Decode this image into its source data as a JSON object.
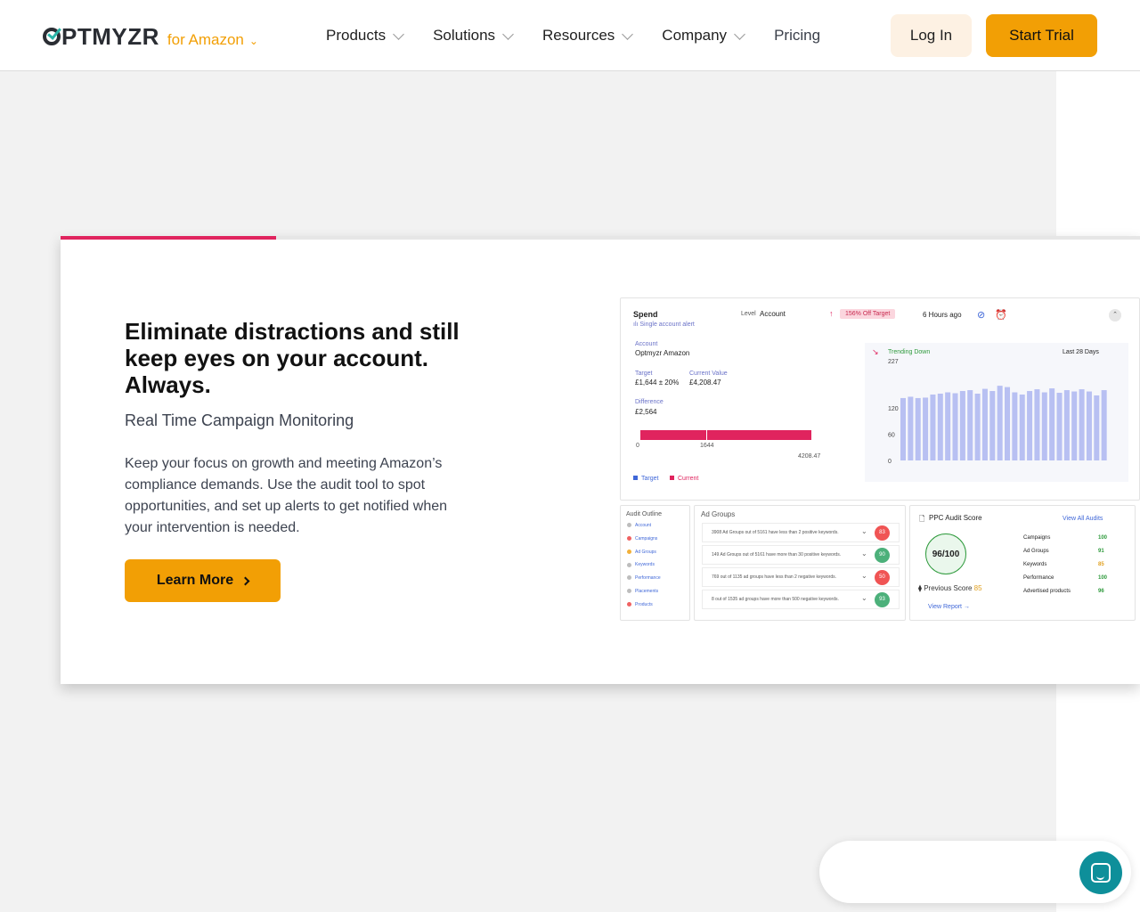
{
  "header": {
    "logo_text": "PTMYZR",
    "logo_suffix": "for Amazon",
    "nav": [
      {
        "label": "Products"
      },
      {
        "label": "Solutions"
      },
      {
        "label": "Resources"
      },
      {
        "label": "Company"
      }
    ],
    "pricing_label": "Pricing",
    "login_label": "Log In",
    "trial_label": "Start Trial"
  },
  "feature": {
    "progress_fraction": 0.2,
    "headline": "Eliminate distractions and still keep eyes on your account. Always.",
    "subheadline": "Real Time Campaign Monitoring",
    "body": "Keep your focus on growth and meeting Amazon’s compliance demands. Use the audit tool to spot opportunities, and set up alerts to get notified when your intervention is needed.",
    "cta_label": "Learn More"
  },
  "dashboard": {
    "spend": {
      "title": "Spend",
      "subtitle": "Single account alert",
      "level_label": "Level",
      "level_value": "Account",
      "badge": "156% Off Target",
      "time": "6 Hours ago",
      "account_label": "Account",
      "account_value": "Optmyzr Amazon",
      "target_label": "Target",
      "target_value": "£1,644 ± 20%",
      "current_label": "Current Value",
      "current_value": "£4,208.47",
      "difference_label": "Difference",
      "difference_value": "£2,564",
      "bar_axis": [
        "0",
        "1644",
        "4208.47"
      ],
      "legend_target": "Target",
      "legend_current": "Current"
    },
    "trend": {
      "label": "Trending Down",
      "range": "Last 28 Days",
      "y_ticks": [
        "227",
        "120",
        "60",
        "0"
      ]
    },
    "audit_outline": {
      "title": "Audit Outline",
      "items": [
        {
          "label": "Account",
          "color": "#bdbdbd"
        },
        {
          "label": "Campaigns",
          "color": "#f06262"
        },
        {
          "label": "Ad Groups",
          "color": "#f2b03a"
        },
        {
          "label": "Keywords",
          "color": "#bdbdbd"
        },
        {
          "label": "Performance",
          "color": "#bdbdbd"
        },
        {
          "label": "Placements",
          "color": "#bdbdbd"
        },
        {
          "label": "Products",
          "color": "#f06262"
        }
      ]
    },
    "ad_groups": {
      "title": "Ad Groups",
      "rows": [
        {
          "text": "3908 Ad Groups out of 5161 have less than 2 positive keywords.",
          "score": "83",
          "color": "#f05454"
        },
        {
          "text": "149 Ad Groups out of 5161 have more than 30 positive keywords.",
          "score": "90",
          "color": "#4cb07a"
        },
        {
          "text": "769 out of 1135 ad groups have less than 2 negative keywords.",
          "score": "50",
          "color": "#f05454"
        },
        {
          "text": "8 out of 1535 ad groups have more than 500 negative keywords.",
          "score": "93",
          "color": "#4cb07a"
        }
      ]
    },
    "audit_score": {
      "title": "PPC Audit Score",
      "view_all": "View All Audits",
      "score": "96/100",
      "previous_label": "Previous Score",
      "previous_value": "85",
      "view_report": "View Report",
      "rows": [
        {
          "label": "Campaigns",
          "value": "100",
          "color": "#2e9a3c"
        },
        {
          "label": "Ad Groups",
          "value": "91",
          "color": "#2e9a3c"
        },
        {
          "label": "Keywords",
          "value": "85",
          "color": "#e0a020"
        },
        {
          "label": "Performance",
          "value": "100",
          "color": "#2e9a3c"
        },
        {
          "label": "Advertised products",
          "value": "96",
          "color": "#2e9a3c"
        }
      ]
    }
  },
  "chart_data": {
    "type": "bar",
    "title": "Trending Down",
    "subtitle": "Last 28 Days",
    "ylim": [
      0,
      227
    ],
    "y_ticks": [
      0,
      60,
      120,
      227
    ],
    "values": [
      142,
      145,
      142,
      143,
      150,
      152,
      155,
      153,
      158,
      160,
      152,
      163,
      158,
      170,
      167,
      155,
      150,
      158,
      162,
      155,
      164,
      154,
      160,
      157,
      162,
      157,
      148,
      160
    ]
  },
  "colors": {
    "brand_orange": "#f29f05",
    "brand_teal": "#2bb5a9",
    "accent_pink": "#e0245e",
    "chart_bar": "#b8c0f2",
    "chat_teal": "#0e8f9a"
  }
}
